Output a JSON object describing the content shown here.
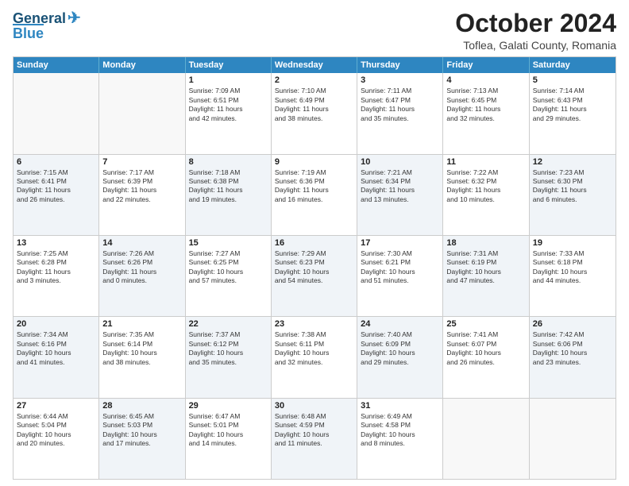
{
  "header": {
    "logo_line1": "General",
    "logo_line2": "Blue",
    "title": "October 2024",
    "subtitle": "Toflea, Galati County, Romania"
  },
  "days_of_week": [
    "Sunday",
    "Monday",
    "Tuesday",
    "Wednesday",
    "Thursday",
    "Friday",
    "Saturday"
  ],
  "rows": [
    [
      {
        "day": "",
        "empty": true
      },
      {
        "day": "",
        "empty": true
      },
      {
        "day": "1",
        "line1": "Sunrise: 7:09 AM",
        "line2": "Sunset: 6:51 PM",
        "line3": "Daylight: 11 hours",
        "line4": "and 42 minutes."
      },
      {
        "day": "2",
        "line1": "Sunrise: 7:10 AM",
        "line2": "Sunset: 6:49 PM",
        "line3": "Daylight: 11 hours",
        "line4": "and 38 minutes."
      },
      {
        "day": "3",
        "line1": "Sunrise: 7:11 AM",
        "line2": "Sunset: 6:47 PM",
        "line3": "Daylight: 11 hours",
        "line4": "and 35 minutes."
      },
      {
        "day": "4",
        "line1": "Sunrise: 7:13 AM",
        "line2": "Sunset: 6:45 PM",
        "line3": "Daylight: 11 hours",
        "line4": "and 32 minutes."
      },
      {
        "day": "5",
        "line1": "Sunrise: 7:14 AM",
        "line2": "Sunset: 6:43 PM",
        "line3": "Daylight: 11 hours",
        "line4": "and 29 minutes."
      }
    ],
    [
      {
        "day": "6",
        "line1": "Sunrise: 7:15 AM",
        "line2": "Sunset: 6:41 PM",
        "line3": "Daylight: 11 hours",
        "line4": "and 26 minutes.",
        "shaded": true
      },
      {
        "day": "7",
        "line1": "Sunrise: 7:17 AM",
        "line2": "Sunset: 6:39 PM",
        "line3": "Daylight: 11 hours",
        "line4": "and 22 minutes."
      },
      {
        "day": "8",
        "line1": "Sunrise: 7:18 AM",
        "line2": "Sunset: 6:38 PM",
        "line3": "Daylight: 11 hours",
        "line4": "and 19 minutes.",
        "shaded": true
      },
      {
        "day": "9",
        "line1": "Sunrise: 7:19 AM",
        "line2": "Sunset: 6:36 PM",
        "line3": "Daylight: 11 hours",
        "line4": "and 16 minutes."
      },
      {
        "day": "10",
        "line1": "Sunrise: 7:21 AM",
        "line2": "Sunset: 6:34 PM",
        "line3": "Daylight: 11 hours",
        "line4": "and 13 minutes.",
        "shaded": true
      },
      {
        "day": "11",
        "line1": "Sunrise: 7:22 AM",
        "line2": "Sunset: 6:32 PM",
        "line3": "Daylight: 11 hours",
        "line4": "and 10 minutes."
      },
      {
        "day": "12",
        "line1": "Sunrise: 7:23 AM",
        "line2": "Sunset: 6:30 PM",
        "line3": "Daylight: 11 hours",
        "line4": "and 6 minutes.",
        "shaded": true
      }
    ],
    [
      {
        "day": "13",
        "line1": "Sunrise: 7:25 AM",
        "line2": "Sunset: 6:28 PM",
        "line3": "Daylight: 11 hours",
        "line4": "and 3 minutes."
      },
      {
        "day": "14",
        "line1": "Sunrise: 7:26 AM",
        "line2": "Sunset: 6:26 PM",
        "line3": "Daylight: 11 hours",
        "line4": "and 0 minutes.",
        "shaded": true
      },
      {
        "day": "15",
        "line1": "Sunrise: 7:27 AM",
        "line2": "Sunset: 6:25 PM",
        "line3": "Daylight: 10 hours",
        "line4": "and 57 minutes."
      },
      {
        "day": "16",
        "line1": "Sunrise: 7:29 AM",
        "line2": "Sunset: 6:23 PM",
        "line3": "Daylight: 10 hours",
        "line4": "and 54 minutes.",
        "shaded": true
      },
      {
        "day": "17",
        "line1": "Sunrise: 7:30 AM",
        "line2": "Sunset: 6:21 PM",
        "line3": "Daylight: 10 hours",
        "line4": "and 51 minutes."
      },
      {
        "day": "18",
        "line1": "Sunrise: 7:31 AM",
        "line2": "Sunset: 6:19 PM",
        "line3": "Daylight: 10 hours",
        "line4": "and 47 minutes.",
        "shaded": true
      },
      {
        "day": "19",
        "line1": "Sunrise: 7:33 AM",
        "line2": "Sunset: 6:18 PM",
        "line3": "Daylight: 10 hours",
        "line4": "and 44 minutes."
      }
    ],
    [
      {
        "day": "20",
        "line1": "Sunrise: 7:34 AM",
        "line2": "Sunset: 6:16 PM",
        "line3": "Daylight: 10 hours",
        "line4": "and 41 minutes.",
        "shaded": true
      },
      {
        "day": "21",
        "line1": "Sunrise: 7:35 AM",
        "line2": "Sunset: 6:14 PM",
        "line3": "Daylight: 10 hours",
        "line4": "and 38 minutes."
      },
      {
        "day": "22",
        "line1": "Sunrise: 7:37 AM",
        "line2": "Sunset: 6:12 PM",
        "line3": "Daylight: 10 hours",
        "line4": "and 35 minutes.",
        "shaded": true
      },
      {
        "day": "23",
        "line1": "Sunrise: 7:38 AM",
        "line2": "Sunset: 6:11 PM",
        "line3": "Daylight: 10 hours",
        "line4": "and 32 minutes."
      },
      {
        "day": "24",
        "line1": "Sunrise: 7:40 AM",
        "line2": "Sunset: 6:09 PM",
        "line3": "Daylight: 10 hours",
        "line4": "and 29 minutes.",
        "shaded": true
      },
      {
        "day": "25",
        "line1": "Sunrise: 7:41 AM",
        "line2": "Sunset: 6:07 PM",
        "line3": "Daylight: 10 hours",
        "line4": "and 26 minutes."
      },
      {
        "day": "26",
        "line1": "Sunrise: 7:42 AM",
        "line2": "Sunset: 6:06 PM",
        "line3": "Daylight: 10 hours",
        "line4": "and 23 minutes.",
        "shaded": true
      }
    ],
    [
      {
        "day": "27",
        "line1": "Sunrise: 6:44 AM",
        "line2": "Sunset: 5:04 PM",
        "line3": "Daylight: 10 hours",
        "line4": "and 20 minutes."
      },
      {
        "day": "28",
        "line1": "Sunrise: 6:45 AM",
        "line2": "Sunset: 5:03 PM",
        "line3": "Daylight: 10 hours",
        "line4": "and 17 minutes.",
        "shaded": true
      },
      {
        "day": "29",
        "line1": "Sunrise: 6:47 AM",
        "line2": "Sunset: 5:01 PM",
        "line3": "Daylight: 10 hours",
        "line4": "and 14 minutes."
      },
      {
        "day": "30",
        "line1": "Sunrise: 6:48 AM",
        "line2": "Sunset: 4:59 PM",
        "line3": "Daylight: 10 hours",
        "line4": "and 11 minutes.",
        "shaded": true
      },
      {
        "day": "31",
        "line1": "Sunrise: 6:49 AM",
        "line2": "Sunset: 4:58 PM",
        "line3": "Daylight: 10 hours",
        "line4": "and 8 minutes."
      },
      {
        "day": "",
        "empty": true
      },
      {
        "day": "",
        "empty": true
      }
    ]
  ]
}
